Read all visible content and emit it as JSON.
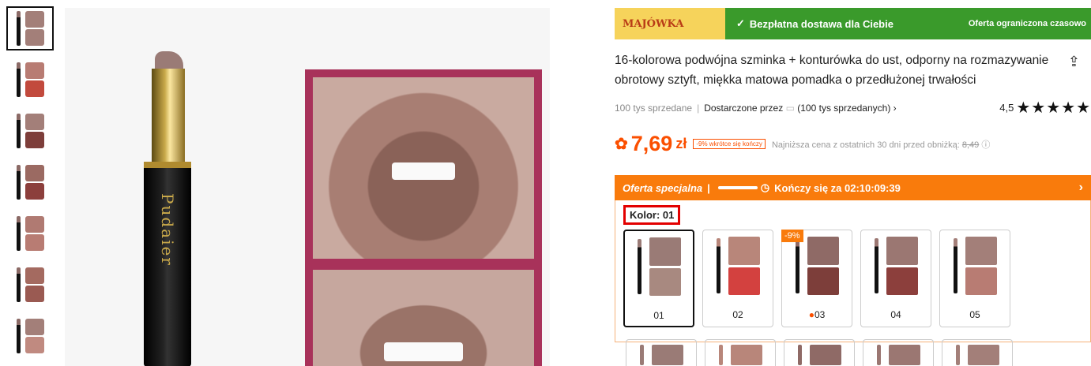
{
  "banner": {
    "badge": "MAJÓWKA",
    "check_icon": "check-icon",
    "text": "Bezpłatna dostawa dla Ciebie",
    "right": "Oferta ograniczona czasowo",
    "colors": {
      "green": "#3a9a2b",
      "badge_bg": "#f6d35b",
      "badge_text": "#b93c16"
    }
  },
  "product": {
    "title": "16-kolorowa podwójna szminka + konturówka do ust, odporny na rozmazywanie obrotowy sztyft, miękka matowa pomadka o przedłużonej trwałości",
    "sold": "100 tys sprzedane",
    "delivered": "Dostarczone przez",
    "seller_sold": "(100 tys sprzedanych)",
    "rating": "4,5",
    "stars": "★★★★★",
    "brand_on_image": "Pudaier"
  },
  "price": {
    "value": "7,69",
    "currency": "zł",
    "tag": "-9% wkrótce się kończy",
    "lowest_label": "Najniższa cena z ostatnich 30 dni przed obniżką:",
    "old": "8,49",
    "color": "#fb4f00"
  },
  "special": {
    "label": "Oferta specjalna",
    "sep": "|",
    "ends": "Kończy się za 02:10:09:39",
    "color": "#f97b0c"
  },
  "kolor": "Kolor: 01",
  "swatches": [
    {
      "label": "01",
      "selected": true,
      "lip": "#9a7b76",
      "lip2": "#a88980"
    },
    {
      "label": "02",
      "lip": "#b8867a",
      "lip2": "#d3413f"
    },
    {
      "label": "03",
      "discount": "-9%",
      "lip": "#8f6a66",
      "lip2": "#7d3e3a"
    },
    {
      "label": "04",
      "lip": "#9b7772",
      "lip2": "#8c3f3c"
    },
    {
      "label": "05",
      "lip": "#a37f79",
      "lip2": "#b87c73"
    }
  ],
  "thumbnails_count": 7
}
